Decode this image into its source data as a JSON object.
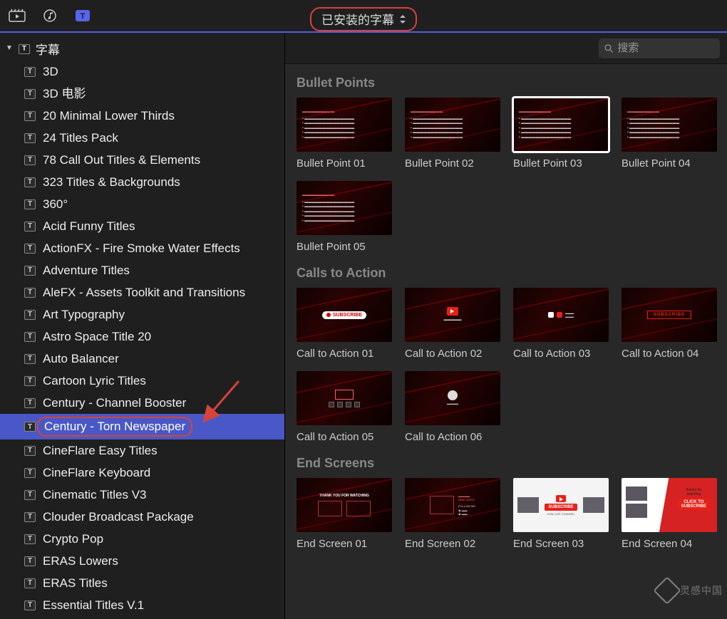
{
  "toolbar": {
    "dropdown_label": "已安装的字幕"
  },
  "sidebar": {
    "root_label": "字幕",
    "root_icon_letter": "T",
    "selected_index": 16,
    "items": [
      "3D",
      "3D 电影",
      "20 Minimal Lower Thirds",
      "24 Titles Pack",
      "78 Call Out Titles & Elements",
      "323 Titles & Backgrounds",
      "360°",
      "Acid Funny Titles",
      "ActionFX - Fire Smoke Water Effects",
      "Adventure Titles",
      "AleFX - Assets Toolkit and Transitions",
      "Art Typography",
      "Astro Space Title 20",
      "Auto Balancer",
      "Cartoon Lyric Titles",
      "Century - Channel Booster",
      "Century - Torn Newspaper",
      "CineFlare Easy Titles",
      "CineFlare Keyboard",
      "Cinematic Titles V3",
      "Clouder Broadcast Package",
      "Crypto Pop",
      "ERAS Lowers",
      "ERAS Titles",
      "Essential Titles V.1"
    ]
  },
  "search": {
    "placeholder": "搜索"
  },
  "sections": [
    {
      "title": "Bullet Points",
      "items": [
        {
          "label": "Bullet Point 01",
          "variant": "bp",
          "selected": false
        },
        {
          "label": "Bullet Point 02",
          "variant": "bp",
          "selected": false
        },
        {
          "label": "Bullet Point 03",
          "variant": "bp",
          "selected": true
        },
        {
          "label": "Bullet Point 04",
          "variant": "bp",
          "selected": false
        },
        {
          "label": "Bullet Point 05",
          "variant": "bp",
          "selected": false
        }
      ]
    },
    {
      "title": "Calls to Action",
      "items": [
        {
          "label": "Call to Action 01",
          "variant": "cta-sub",
          "selected": false
        },
        {
          "label": "Call to Action 02",
          "variant": "cta-yt",
          "selected": false
        },
        {
          "label": "Call to Action 03",
          "variant": "cta-icons",
          "selected": false
        },
        {
          "label": "Call to Action 04",
          "variant": "cta-wide",
          "selected": false
        },
        {
          "label": "Call to Action 05",
          "variant": "cta-grid",
          "selected": false
        },
        {
          "label": "Call to Action 06",
          "variant": "cta-prof",
          "selected": false
        }
      ]
    },
    {
      "title": "End Screens",
      "items": [
        {
          "label": "End Screen 01",
          "variant": "es-dark",
          "selected": false
        },
        {
          "label": "End Screen 02",
          "variant": "es-follow",
          "selected": false
        },
        {
          "label": "End Screen 03",
          "variant": "es-white",
          "selected": false
        },
        {
          "label": "End Screen 04",
          "variant": "es-half",
          "selected": false
        }
      ]
    }
  ],
  "watermark": "灵感中国"
}
